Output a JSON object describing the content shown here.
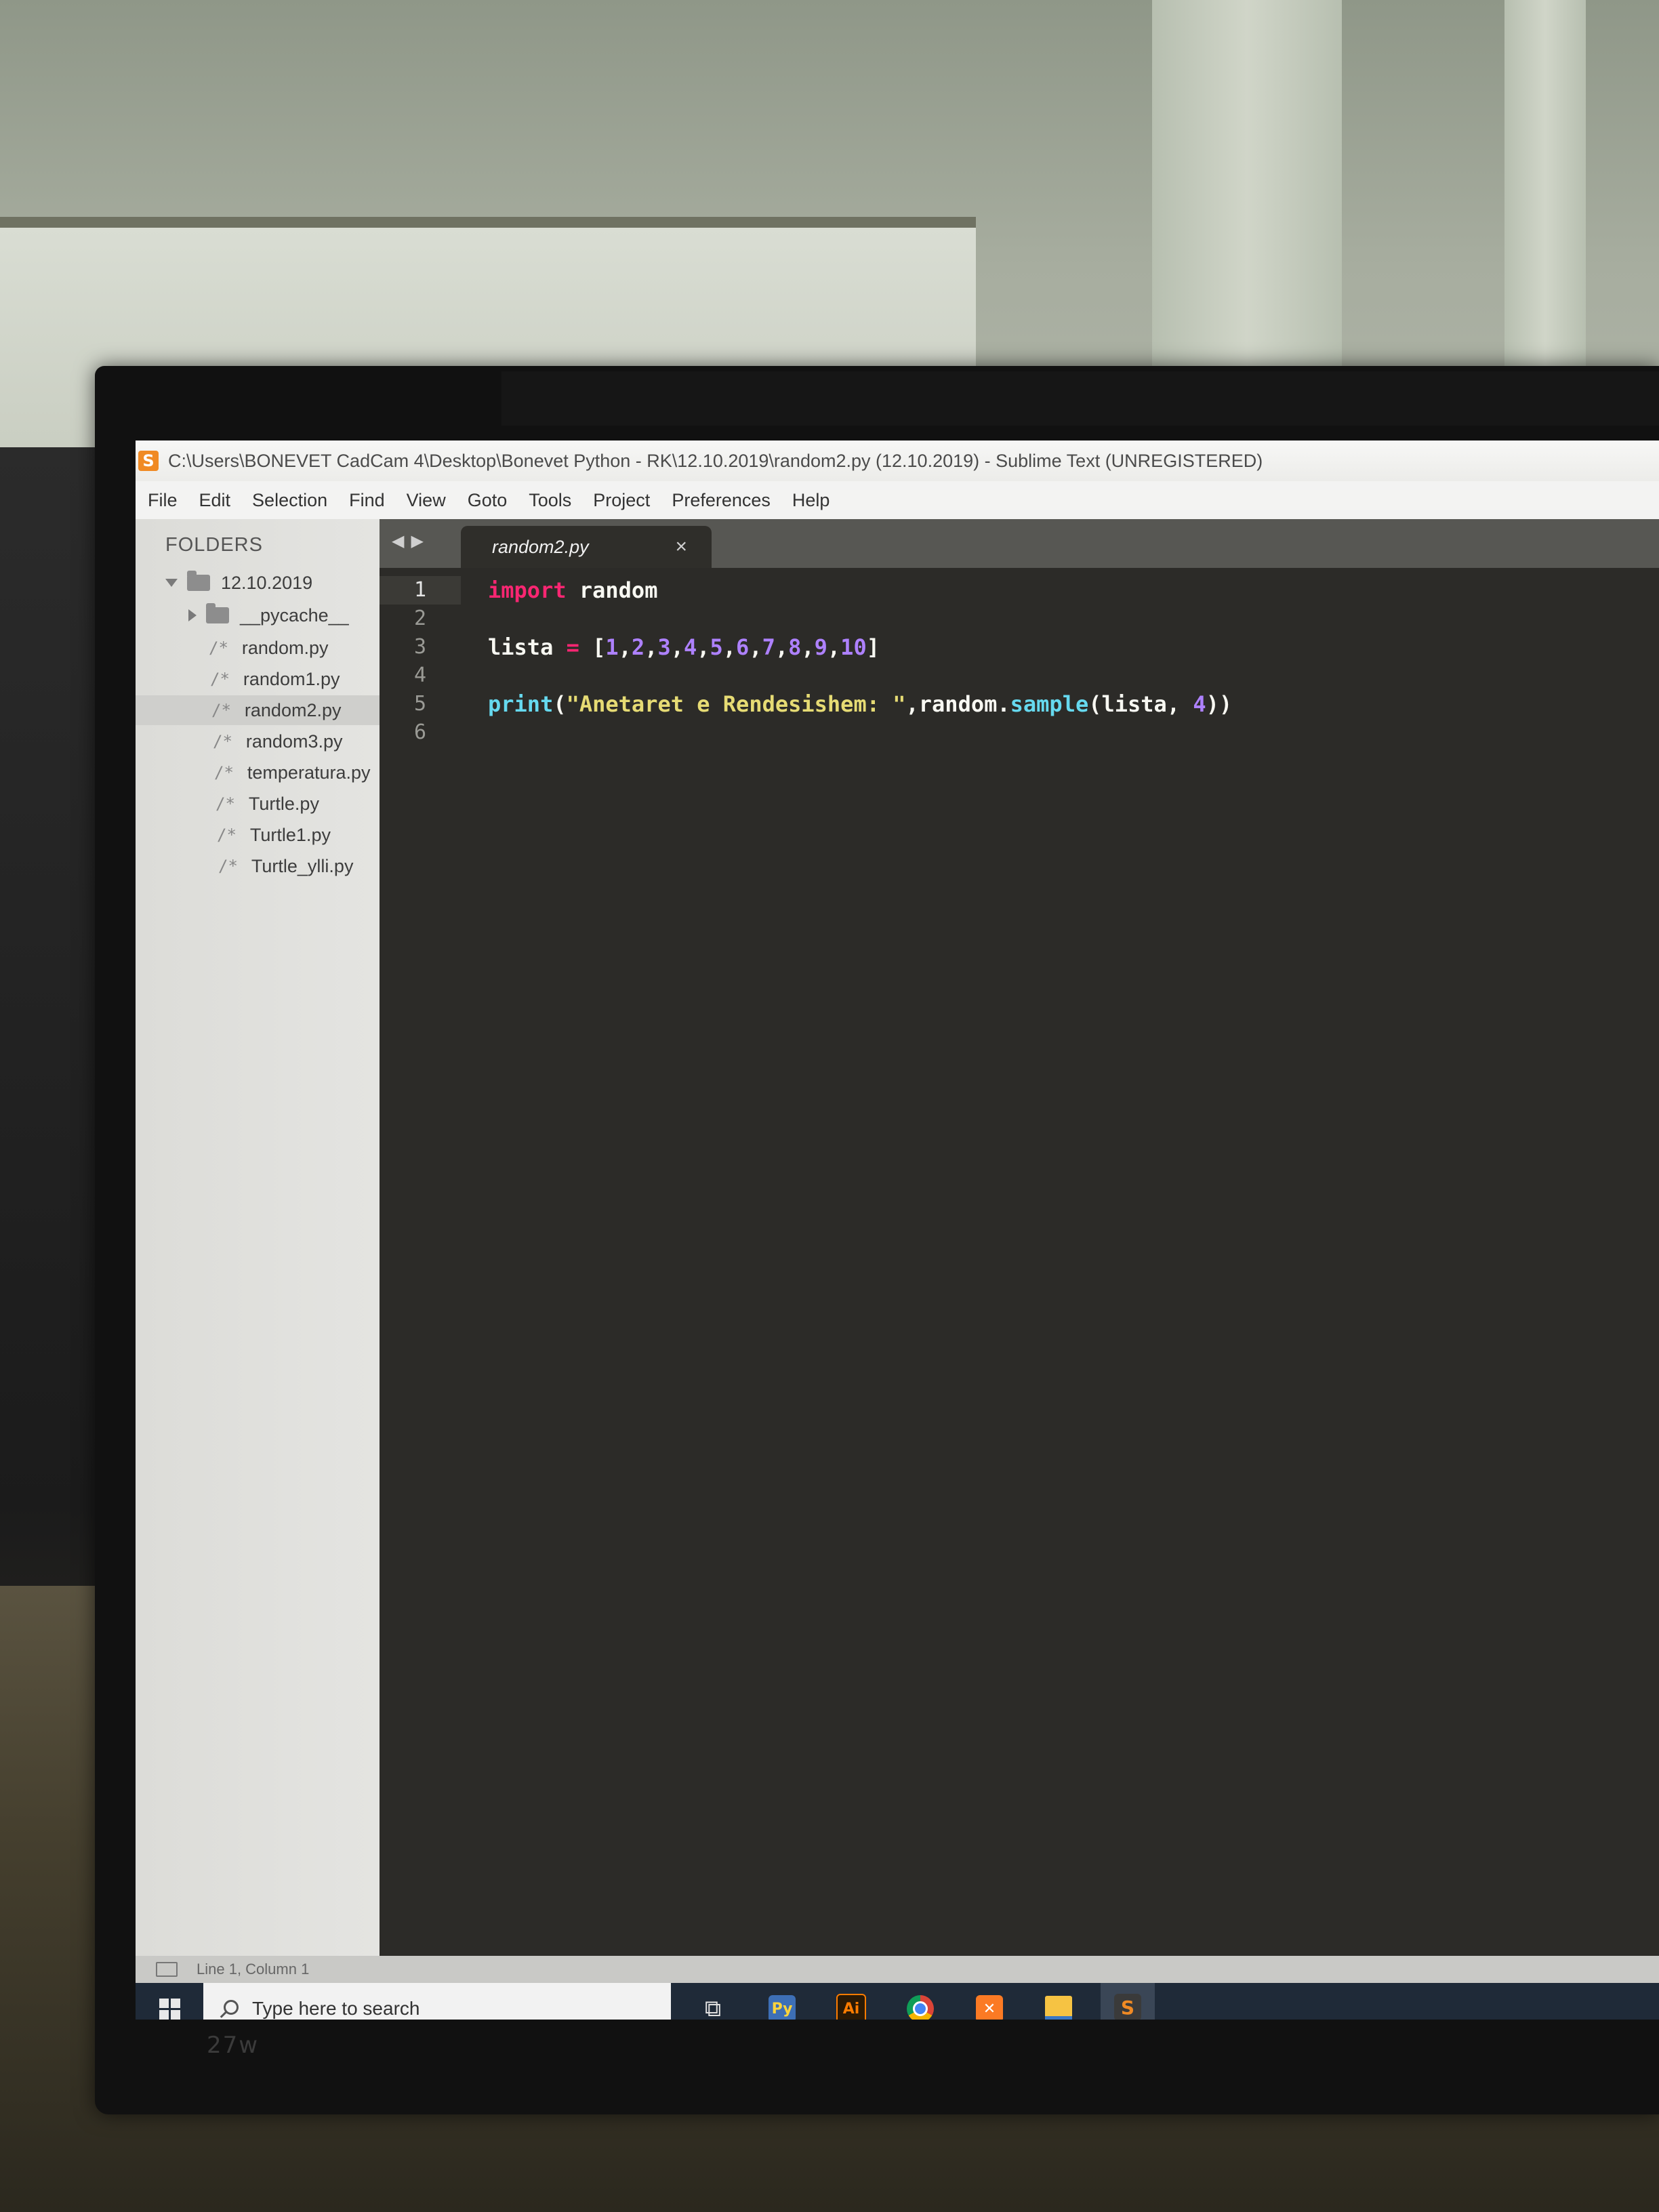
{
  "window": {
    "title": "C:\\Users\\BONEVET CadCam 4\\Desktop\\Bonevet Python - RK\\12.10.2019\\random2.py (12.10.2019) - Sublime Text (UNREGISTERED)",
    "app_icon": "sublime-text-icon"
  },
  "menu": {
    "items": [
      "File",
      "Edit",
      "Selection",
      "Find",
      "View",
      "Goto",
      "Tools",
      "Project",
      "Preferences",
      "Help"
    ]
  },
  "sidebar": {
    "header": "FOLDERS",
    "root_folder": "12.10.2019",
    "subfolder": "__pycache__",
    "files": [
      "random.py",
      "random1.py",
      "random2.py",
      "random3.py",
      "temperatura.py",
      "Turtle.py",
      "Turtle1.py",
      "Turtle_ylli.py"
    ],
    "file_icon": "/*",
    "selected_file": "random2.py"
  },
  "tabs": {
    "active": "random2.py",
    "close_glyph": "×",
    "nav_back": "◀",
    "nav_forward": "▶"
  },
  "editor": {
    "line_numbers": [
      "1",
      "2",
      "3",
      "4",
      "5",
      "6"
    ],
    "current_line": 1,
    "line1": {
      "kw": "import",
      "rest": " random"
    },
    "line3": {
      "var": "lista ",
      "eq": "=",
      "open": " [",
      "items": [
        "1",
        "2",
        "3",
        "4",
        "5",
        "6",
        "7",
        "8",
        "9",
        "10"
      ],
      "close": "]"
    },
    "line5": {
      "fn": "print",
      "open": "(",
      "str": "\"Anetaret e Rendesishem: \"",
      "mid": ",random.",
      "method": "sample",
      "args_open": "(lista, ",
      "num": "4",
      "args_close": "))"
    }
  },
  "status": {
    "position": "Line 1, Column 1"
  },
  "taskbar": {
    "search_placeholder": "Type here to search",
    "apps": [
      {
        "name": "task-view-icon",
        "glyph": "⧉"
      },
      {
        "name": "python-idle-icon",
        "glyph": "Py",
        "color": "#3d6fb6"
      },
      {
        "name": "illustrator-icon",
        "glyph": "Ai",
        "color": "#ff7c00"
      },
      {
        "name": "chrome-icon",
        "glyph": "",
        "color": "#db4437"
      },
      {
        "name": "xampp-icon",
        "glyph": "✕",
        "color": "#fb7a24"
      },
      {
        "name": "file-explorer-icon",
        "glyph": "",
        "color": "#f6c343"
      },
      {
        "name": "sublime-text-taskbar-icon",
        "glyph": "S",
        "color": "#f08a24"
      }
    ]
  },
  "monitor": {
    "model": "27w"
  },
  "colors": {
    "keyword": "#f92672",
    "number": "#ae81ff",
    "function": "#66d9ef",
    "string": "#e6db74",
    "editor_bg": "#2c2b28"
  }
}
